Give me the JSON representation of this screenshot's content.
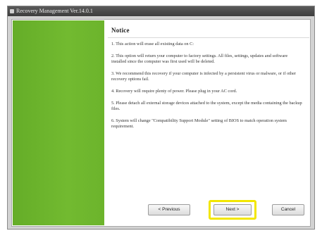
{
  "window": {
    "title": "Recovery Management Ver.14.0.1"
  },
  "notice": {
    "title": "Notice",
    "items": [
      "1. This action will erase all existing data on C:",
      "2. This option will return your computer to factory settings. All files, settings, updates and software installed since the computer was first used will be deleted.",
      "3. We recommend this recovery if your computer is infected by a persistent virus or malware, or if other recovery options fail.",
      "4. Recovery will require plenty of power. Please plug in your AC cord.",
      "5. Please detach all external storage devices attached to the system, except the media containing the backup files.",
      "6. System will change \"Compatibility Support Module\" setting of BIOS to match operation system requirement."
    ]
  },
  "buttons": {
    "previous_label": "< Previous",
    "next_label": "Next >",
    "cancel_label": "Cancel"
  },
  "colors": {
    "sidebar_green": "#6cb42c",
    "highlight_yellow": "#f2e600"
  }
}
